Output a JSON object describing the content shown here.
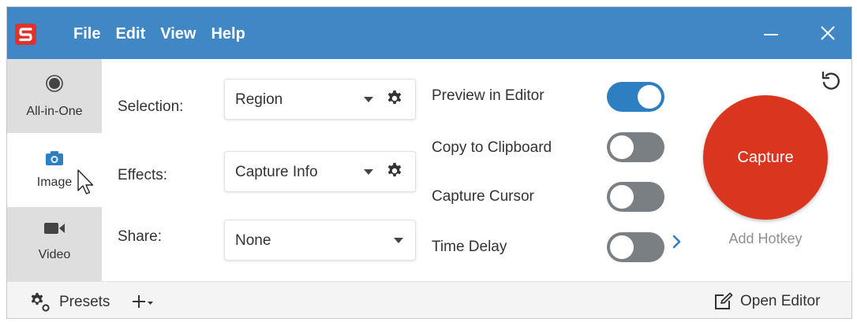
{
  "menu": {
    "items": [
      "File",
      "Edit",
      "View",
      "Help"
    ]
  },
  "tabs": [
    {
      "label": "All-in-One",
      "icon": "record-icon"
    },
    {
      "label": "Image",
      "icon": "camera-icon"
    },
    {
      "label": "Video",
      "icon": "video-camera-icon"
    }
  ],
  "settings": {
    "selection": {
      "label": "Selection:",
      "value": "Region"
    },
    "effects": {
      "label": "Effects:",
      "value": "Capture Info"
    },
    "share": {
      "label": "Share:",
      "value": "None"
    }
  },
  "options": [
    {
      "label": "Preview in Editor",
      "on": true
    },
    {
      "label": "Copy to Clipboard",
      "on": false
    },
    {
      "label": "Capture Cursor",
      "on": false
    },
    {
      "label": "Time Delay",
      "on": false
    }
  ],
  "capture": {
    "label": "Capture",
    "hotkey_label": "Add Hotkey"
  },
  "footer": {
    "presets_label": "Presets",
    "open_editor_label": "Open Editor"
  },
  "colors": {
    "titlebar": "#3f88c5",
    "capture": "#d9351f",
    "toggle_on": "#2e7fc2",
    "toggle_off": "#7a7f84",
    "logo": "#e2312a"
  }
}
